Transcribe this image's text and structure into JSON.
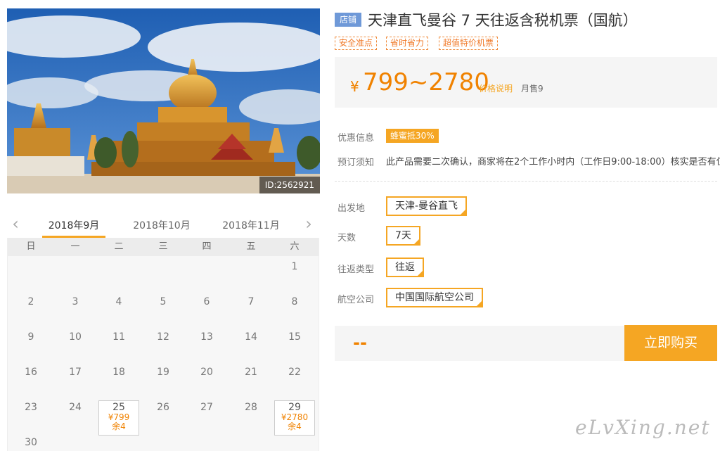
{
  "hero": {
    "id_label": "ID:2562921"
  },
  "calendar": {
    "months": [
      "2018年9月",
      "2018年10月",
      "2018年11月"
    ],
    "weekdays": [
      "日",
      "一",
      "二",
      "三",
      "四",
      "五",
      "六"
    ],
    "days": [
      {
        "d": "1"
      },
      {
        "d": "2"
      },
      {
        "d": "3"
      },
      {
        "d": "4"
      },
      {
        "d": "5"
      },
      {
        "d": "6"
      },
      {
        "d": "7"
      },
      {
        "d": "8"
      },
      {
        "d": "9"
      },
      {
        "d": "10"
      },
      {
        "d": "11"
      },
      {
        "d": "12"
      },
      {
        "d": "13"
      },
      {
        "d": "14"
      },
      {
        "d": "15"
      },
      {
        "d": "16"
      },
      {
        "d": "17"
      },
      {
        "d": "18"
      },
      {
        "d": "19"
      },
      {
        "d": "20"
      },
      {
        "d": "21"
      },
      {
        "d": "22"
      },
      {
        "d": "23"
      },
      {
        "d": "24"
      },
      {
        "d": "25",
        "price": "¥799",
        "remain": "余4"
      },
      {
        "d": "26"
      },
      {
        "d": "27"
      },
      {
        "d": "28"
      },
      {
        "d": "29",
        "price": "¥2780",
        "remain": "余4"
      },
      {
        "d": "30"
      }
    ]
  },
  "product": {
    "store_badge": "店铺",
    "title": "天津直飞曼谷 7 天往返含税机票（国航）",
    "tags": [
      "安全准点",
      "省时省力",
      "超值特价机票"
    ]
  },
  "price": {
    "currency": "¥",
    "range": "799~2780",
    "note": "价格说明",
    "sold": "月售9"
  },
  "info": {
    "promo_label": "优惠信息",
    "promo_badge": "蜂蜜抵30%",
    "notice_label": "预订须知",
    "notice_text": "此产品需要二次确认，商家将在2个工作小时内（工作日9:00-18:00）核实是否有位!"
  },
  "options": {
    "departure_label": "出发地",
    "departure_value": "天津-曼谷直飞",
    "days_label": "天数",
    "days_value": "7天",
    "trip_label": "往返类型",
    "trip_value": "往返",
    "airline_label": "航空公司",
    "airline_value": "中国国际航空公司"
  },
  "buy": {
    "total": "--",
    "button": "立即购买"
  },
  "watermark": "eLvXing.net",
  "icons": {
    "prev": "chevron-left-icon",
    "next": "chevron-right-icon"
  },
  "colors": {
    "accent": "#f5a623",
    "price": "#f08200",
    "badge_blue": "#6f99d8"
  }
}
